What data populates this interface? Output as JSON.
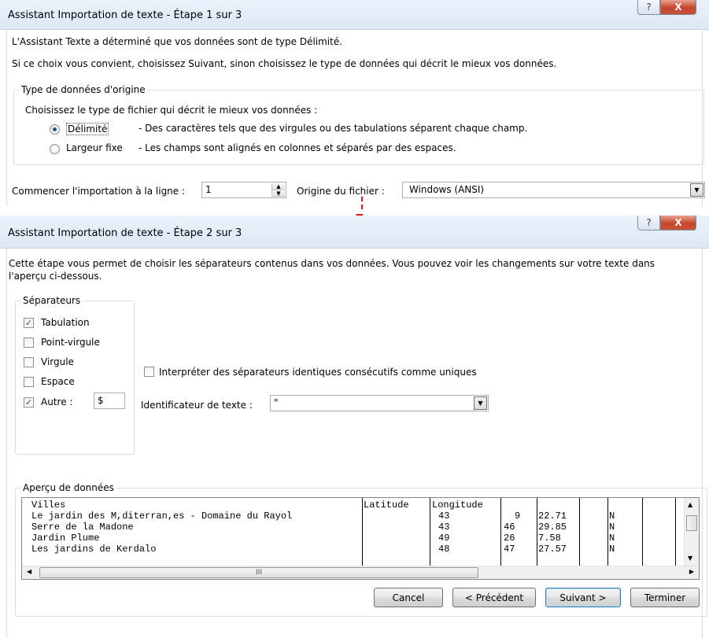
{
  "step1": {
    "title": "Assistant Importation de texte - Étape 1 sur 3",
    "help_glyph": "?",
    "close_glyph": "X",
    "intro_1": "L'Assistant Texte a déterminé que vos données sont de type Délimité.",
    "intro_2": "Si ce choix vous convient, choisissez Suivant, sinon choisissez le type de données qui décrit le mieux vos données.",
    "group_label": "Type de données d'origine",
    "choose_label": "Choisissez le type de fichier qui décrit le mieux vos données :",
    "option_delimited": "Délimité",
    "option_delimited_desc": "- Des caractères tels que des virgules ou des tabulations séparent chaque champ.",
    "option_fixed": "Largeur fixe",
    "option_fixed_desc": "- Les champs sont alignés en colonnes et séparés par des espaces.",
    "start_row_label": "Commencer l'importation à la ligne :",
    "start_row_value": "1",
    "origin_label": "Origine du fichier :",
    "origin_value": "Windows (ANSI)"
  },
  "step2": {
    "title": "Assistant Importation de texte - Étape 2 sur 3",
    "help_glyph": "?",
    "close_glyph": "X",
    "intro": "Cette étape vous permet de choisir les séparateurs contenus dans vos données. Vous pouvez voir les changements sur votre texte dans",
    "intro_line2": "l'aperçu ci-dessous.",
    "separators_label": "Séparateurs",
    "separators": [
      {
        "label": "Tabulation",
        "checked": true
      },
      {
        "label": "Point-virgule",
        "checked": false
      },
      {
        "label": "Virgule",
        "checked": false
      },
      {
        "label": "Espace",
        "checked": false
      },
      {
        "label": "Autre :",
        "checked": true
      }
    ],
    "other_value": "$",
    "consecutive_label": "Interpréter des séparateurs identiques consécutifs comme uniques",
    "consecutive_checked": false,
    "text_qualifier_label": "Identificateur de texte :",
    "text_qualifier_value": "\"",
    "preview_label": "Aperçu de données",
    "preview_rows": [
      [
        "Villes",
        "Latitude",
        "Longitude",
        "",
        "",
        "",
        "",
        "",
        ""
      ],
      [
        "Le jardin des M,diterran,es - Domaine du Rayol",
        "",
        "43",
        "9",
        "22.71",
        "",
        "N",
        "",
        ""
      ],
      [
        "Serre de la Madone",
        "",
        "43",
        "46",
        "29.85",
        "",
        "N",
        "",
        ""
      ],
      [
        "Jardin Plume",
        "",
        "49",
        "26",
        "7.58",
        "",
        "N",
        "",
        ""
      ],
      [
        "Les jardins de Kerdalo",
        "",
        "48",
        "47",
        "27.57",
        "",
        "N",
        "",
        ""
      ]
    ],
    "buttons": {
      "cancel": "Cancel",
      "previous": "< Précédent",
      "next": "Suivant >",
      "finish": "Terminer"
    },
    "scroll_grip": "III"
  },
  "colors": {
    "title_bg": "#dde8f6",
    "close_red": "#c5442b",
    "connector_red": "#e8141b",
    "group_border": "#d5dfe5"
  }
}
